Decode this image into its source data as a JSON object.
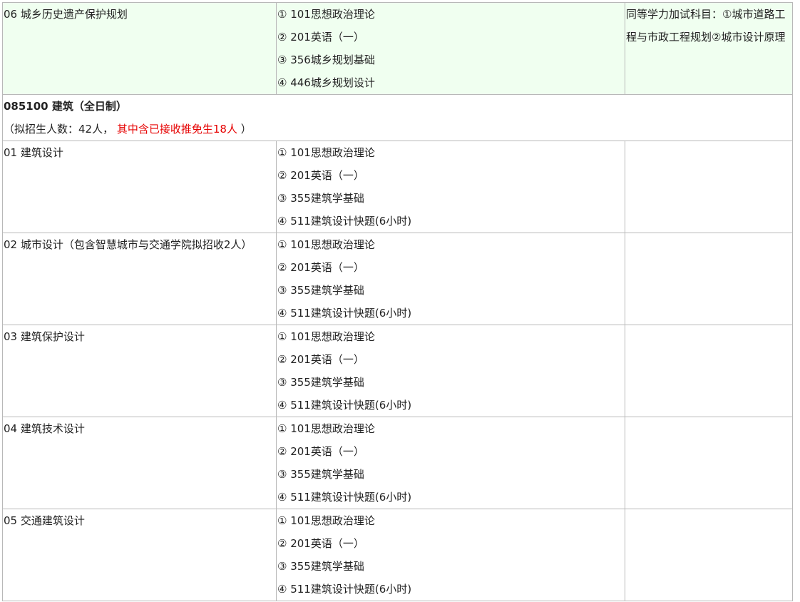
{
  "top_row": {
    "direction": "06 城乡历史遗产保护规划",
    "exams": [
      "① 101思想政治理论",
      "② 201英语（一）",
      "③ 356城乡规划基础",
      "④ 446城乡规划设计"
    ],
    "note": "同等学力加试科目：①城市道路工程与市政工程规划②城市设计原理"
  },
  "program": {
    "title": "085100 建筑（全日制）",
    "quota_prefix": "（拟招生人数：42人，",
    "quota_highlight": "其中含已接收推免生18人",
    "quota_suffix": "）"
  },
  "rows": [
    {
      "direction": "01 建筑设计",
      "exams": [
        "① 101思想政治理论",
        "② 201英语（一）",
        "③ 355建筑学基础",
        "④ 511建筑设计快题(6小时)"
      ],
      "note": ""
    },
    {
      "direction": "02 城市设计（包含智慧城市与交通学院拟招收2人）",
      "exams": [
        "① 101思想政治理论",
        "② 201英语（一）",
        "③ 355建筑学基础",
        "④ 511建筑设计快题(6小时)"
      ],
      "note": ""
    },
    {
      "direction": "03 建筑保护设计",
      "exams": [
        "① 101思想政治理论",
        "② 201英语（一）",
        "③ 355建筑学基础",
        "④ 511建筑设计快题(6小时)"
      ],
      "note": ""
    },
    {
      "direction": "04 建筑技术设计",
      "exams": [
        "① 101思想政治理论",
        "② 201英语（一）",
        "③ 355建筑学基础",
        "④ 511建筑设计快题(6小时)"
      ],
      "note": ""
    },
    {
      "direction": "05 交通建筑设计",
      "exams": [
        "① 101思想政治理论",
        "② 201英语（一）",
        "③ 355建筑学基础",
        "④ 511建筑设计快题(6小时)"
      ],
      "note": ""
    }
  ]
}
